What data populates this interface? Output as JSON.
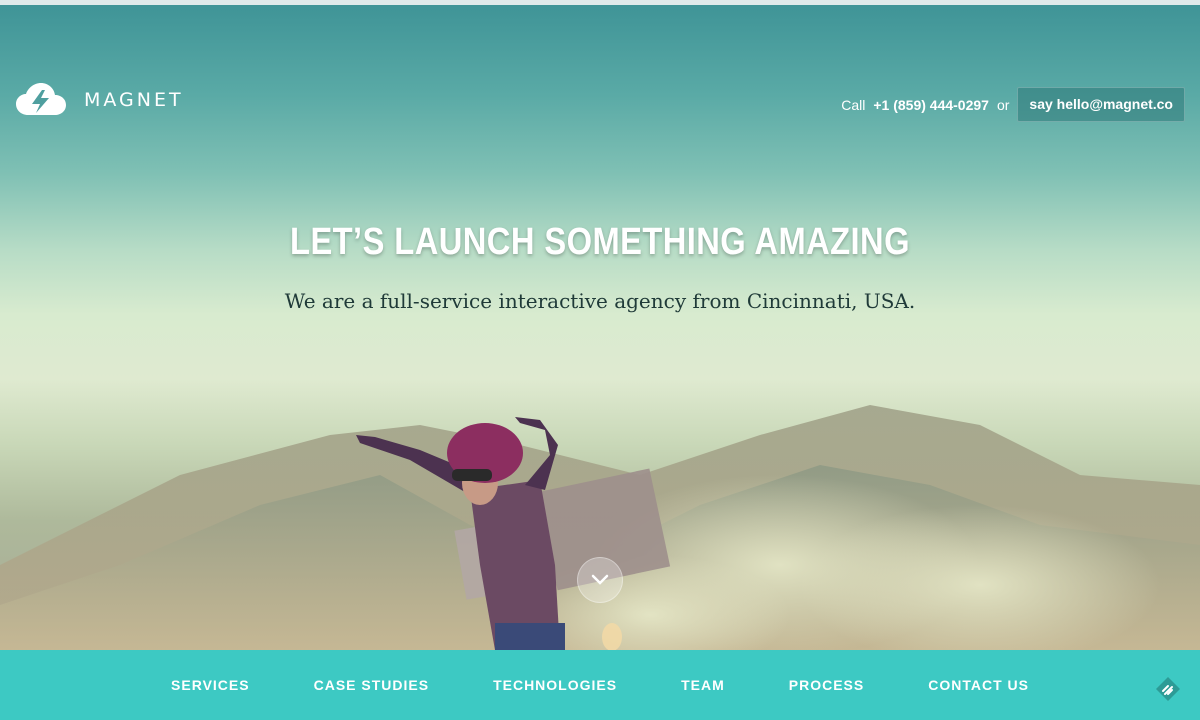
{
  "brand": {
    "name": "MAGNET",
    "logo_icon": "cloud-lightning-icon"
  },
  "header": {
    "call_prefix": "Call",
    "phone": "+1 (859) 444-0297",
    "or_text": "or",
    "email_button": "say hello@magnet.co"
  },
  "hero": {
    "headline": "LET’S LAUNCH SOMETHING AMAZING",
    "subline": "We are a full-service interactive agency from Cincinnati, USA.",
    "scroll_icon": "chevron-down-icon"
  },
  "nav": {
    "items": [
      "SERVICES",
      "CASE STUDIES",
      "TECHNOLOGIES",
      "TEAM",
      "PROCESS",
      "CONTACT US"
    ],
    "feedback_icon": "feedback-icon"
  },
  "colors": {
    "nav_bg": "#3dc9c3",
    "sky_top": "#3f9497",
    "headline": "#ffffff",
    "subline": "#1f3a38"
  }
}
